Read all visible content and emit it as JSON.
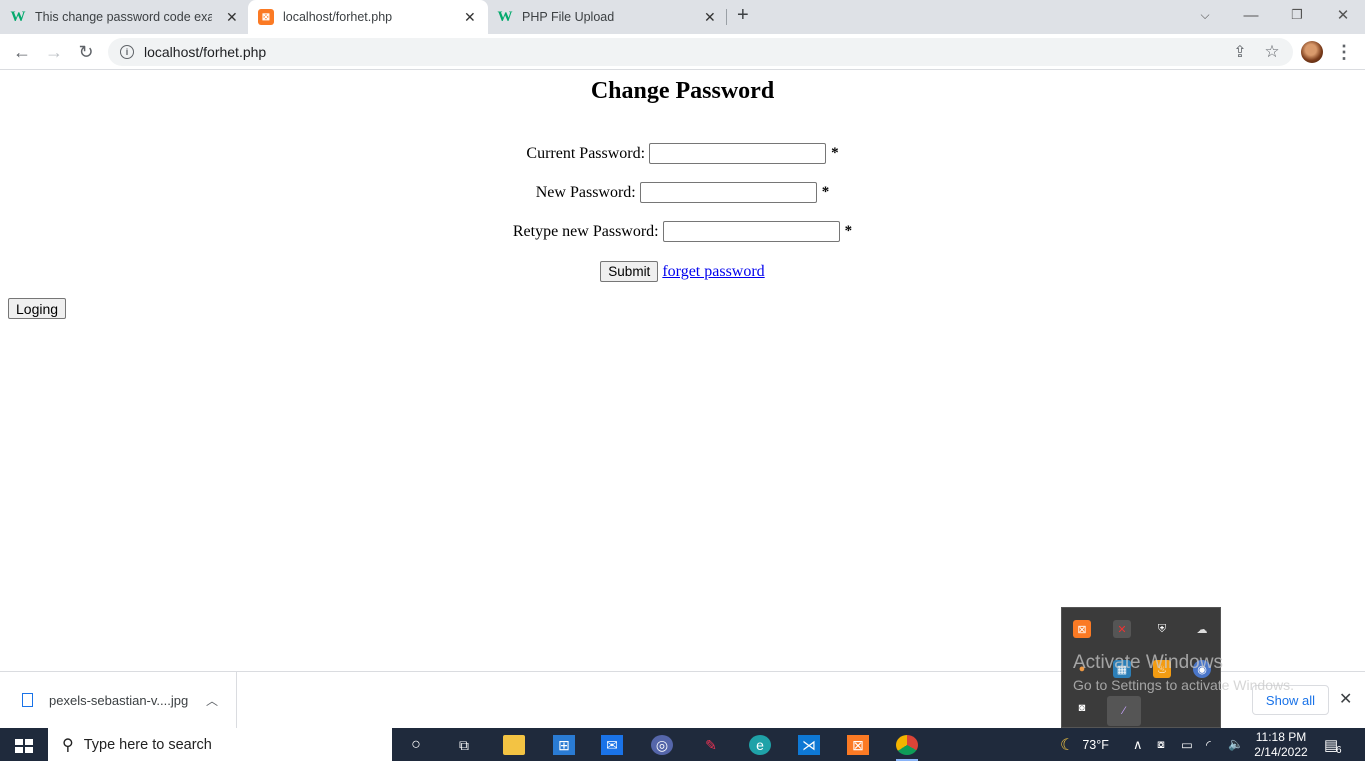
{
  "browser": {
    "tabs": [
      {
        "title": "This change password code exam",
        "favicon": "w3schools-icon",
        "active": false
      },
      {
        "title": "localhost/forhet.php",
        "favicon": "xampp-icon",
        "active": true
      },
      {
        "title": "PHP File Upload",
        "favicon": "w3schools-icon",
        "active": false
      }
    ],
    "new_tab_glyph": "+",
    "address": "localhost/forhet.php"
  },
  "page": {
    "heading": "Change Password",
    "fields": [
      {
        "label": "Current Password:",
        "value": "",
        "required_mark": "*"
      },
      {
        "label": "New Password:",
        "value": "",
        "required_mark": "*"
      },
      {
        "label": "Retype new Password:",
        "value": "",
        "required_mark": "*"
      }
    ],
    "submit_label": "Submit",
    "forget_link": "forget password",
    "login_button": "Loging"
  },
  "downloads": {
    "file_name": "pexels-sebastian-v....jpg",
    "show_all": "Show all"
  },
  "watermark": {
    "line1": "Activate Windows",
    "line2": "Go to Settings to activate Windows."
  },
  "taskbar": {
    "search_placeholder": "Type here to search",
    "weather": "73°F",
    "time": "11:18 PM",
    "date": "2/14/2022",
    "notification_count": "6"
  },
  "colors": {
    "tabstrip": "#dee1e6",
    "link": "#0000ee",
    "taskbar": "#1f2a3c",
    "accent": "#1a73e8"
  }
}
